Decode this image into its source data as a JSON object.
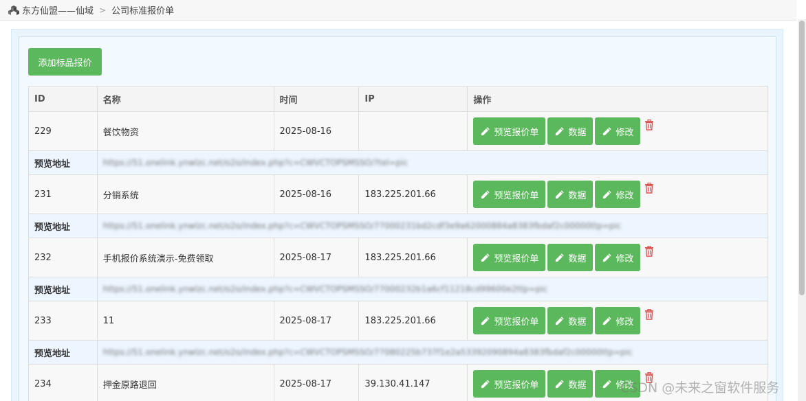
{
  "breadcrumb": {
    "site": "东方仙盟——仙域",
    "separator": ">",
    "page": "公司标准报价单"
  },
  "toolbar": {
    "add_label": "添加标品报价"
  },
  "table": {
    "headers": [
      "ID",
      "名称",
      "时间",
      "IP",
      "操作"
    ],
    "preview_label": "预览地址",
    "actions": {
      "preview": "预览报价单",
      "data": "数据",
      "edit": "修改"
    },
    "rows": [
      {
        "id": "229",
        "name": "餐饮物资",
        "time": "2025-08-16",
        "ip": "",
        "preview_url": "https://51.onelink.ynwlzc.net/o2o/index.php?c=CWVCTOPSMSSO/?tel=pic"
      },
      {
        "id": "231",
        "name": "分销系统",
        "time": "2025-08-16",
        "ip": "183.225.201.66",
        "preview_url": "https://51.onelink.ynwlzc.net/o2o/index.php?c=CWVCTOPSMSSO/77000231bd2cdf3e9a62000884a8383fbdaf2c00000ttp=pic"
      },
      {
        "id": "232",
        "name": "手机报价系统演示-免费领取",
        "time": "2025-08-17",
        "ip": "183.225.201.66",
        "preview_url": "https://51.onelink.ynwlzc.net/o2o/index.php?c=CWVCTOPSMSSO/77000232b1a6cf11218cd99600e2ttp=pic"
      },
      {
        "id": "233",
        "name": "11",
        "time": "2025-08-17",
        "ip": "183.225.201.66",
        "preview_url": "https://51.onelink.ynwlzc.net/o2o/index.php?c=CWVCTOPSMSSO/77080225b737f1e2a53392090894a8383fbdaf2c00000ttp=pic"
      },
      {
        "id": "234",
        "name": "押金原路退回",
        "time": "2025-08-17",
        "ip": "39.130.41.147",
        "preview_url": ""
      }
    ]
  },
  "watermark": "CSDN @未来之窗软件服务",
  "colors": {
    "primary_green": "#5cb85c",
    "trash_red": "#d9534f",
    "panel_bg": "#f2f9ff"
  }
}
